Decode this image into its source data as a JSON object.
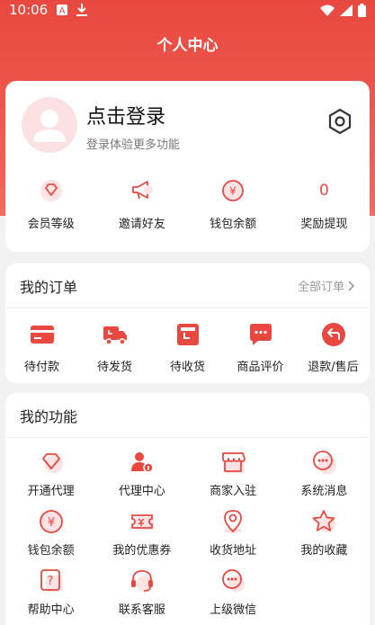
{
  "status": {
    "time": "10:06"
  },
  "nav": {
    "title": "个人中心"
  },
  "profile": {
    "login_title": "点击登录",
    "login_sub": "登录体验更多功能"
  },
  "stats": [
    {
      "icon": "vip-diamond-icon",
      "label": "会员等级"
    },
    {
      "icon": "megaphone-icon",
      "label": "邀请好友"
    },
    {
      "icon": "yuan-coin-icon",
      "label": "钱包余额"
    },
    {
      "value": "0",
      "label": "奖励提现"
    }
  ],
  "orders": {
    "title": "我的订单",
    "more": "全部订单",
    "items": [
      {
        "icon": "wallet-card-icon",
        "label": "待付款"
      },
      {
        "icon": "truck-icon",
        "label": "待发货"
      },
      {
        "icon": "package-box-icon",
        "label": "待收货"
      },
      {
        "icon": "chat-bubble-icon",
        "label": "商品评价"
      },
      {
        "icon": "return-arrow-icon",
        "label": "退款/售后"
      }
    ]
  },
  "functions": {
    "title": "我的功能",
    "items": [
      {
        "icon": "diamond-icon",
        "label": "开通代理"
      },
      {
        "icon": "agent-person-icon",
        "label": "代理中心"
      },
      {
        "icon": "store-icon",
        "label": "商家入驻"
      },
      {
        "icon": "message-icon",
        "label": "系统消息"
      },
      {
        "icon": "yuan-coin-icon",
        "label": "钱包余额"
      },
      {
        "icon": "coupon-icon",
        "label": "我的优惠券"
      },
      {
        "icon": "location-pin-icon",
        "label": "收货地址"
      },
      {
        "icon": "star-icon",
        "label": "我的收藏"
      },
      {
        "icon": "help-icon",
        "label": "帮助中心"
      },
      {
        "icon": "headset-icon",
        "label": "联系客服"
      },
      {
        "icon": "wechat-chat-icon",
        "label": "上级微信"
      }
    ]
  },
  "colors": {
    "primary": "#e8483f",
    "icon_light": "#fbdcdc",
    "background": "#f2f2f2"
  }
}
